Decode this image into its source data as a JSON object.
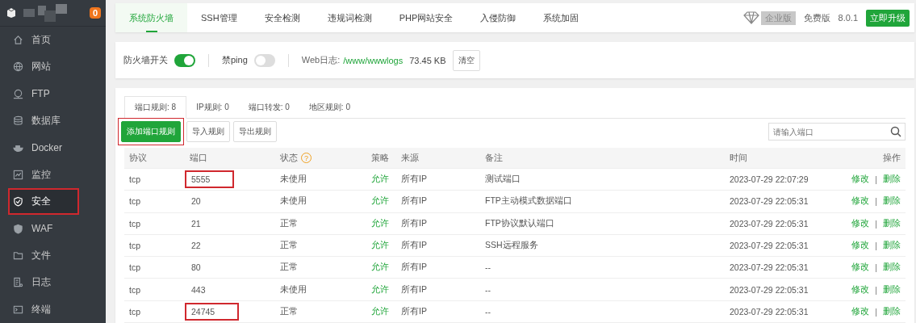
{
  "sidebar": {
    "badge": "0",
    "items": [
      {
        "label": "首页",
        "selected": false,
        "annotated": false
      },
      {
        "label": "网站",
        "selected": false,
        "annotated": false
      },
      {
        "label": "FTP",
        "selected": false,
        "annotated": false
      },
      {
        "label": "数据库",
        "selected": false,
        "annotated": false
      },
      {
        "label": "Docker",
        "selected": false,
        "annotated": false
      },
      {
        "label": "监控",
        "selected": false,
        "annotated": false
      },
      {
        "label": "安全",
        "selected": true,
        "annotated": true
      },
      {
        "label": "WAF",
        "selected": false,
        "annotated": false
      },
      {
        "label": "文件",
        "selected": false,
        "annotated": false
      },
      {
        "label": "日志",
        "selected": false,
        "annotated": false
      },
      {
        "label": "终端",
        "selected": false,
        "annotated": false
      }
    ]
  },
  "tabs": [
    {
      "label": "系统防火墙",
      "selected": true
    },
    {
      "label": "SSH管理",
      "selected": false
    },
    {
      "label": "安全检测",
      "selected": false
    },
    {
      "label": "违规词检测",
      "selected": false
    },
    {
      "label": "PHP网站安全",
      "selected": false
    },
    {
      "label": "入侵防御",
      "selected": false
    },
    {
      "label": "系统加固",
      "selected": false
    }
  ],
  "edition": {
    "enterprise": "企业版",
    "free": "免费版",
    "version": "8.0.1",
    "upgrade": "立即升级"
  },
  "controls": {
    "firewall": {
      "label": "防火墙开关",
      "on": true
    },
    "ping": {
      "label": "禁ping",
      "on": false
    },
    "web_log_label": "Web日志:",
    "web_log_path": "/www/wwwlogs",
    "web_log_size": "73.45 KB",
    "clear": "清空"
  },
  "sub_tabs": [
    {
      "label": "端口规则: 8",
      "selected": true
    },
    {
      "label": "IP规则: 0",
      "selected": false
    },
    {
      "label": "端口转发: 0",
      "selected": false
    },
    {
      "label": "地区规则: 0",
      "selected": false
    }
  ],
  "actions": [
    {
      "label": "添加端口规则",
      "kind": "primary",
      "annotated": true
    },
    {
      "label": "导入规则",
      "kind": "default",
      "annotated": false
    },
    {
      "label": "导出规则",
      "kind": "default",
      "annotated": false
    }
  ],
  "search": {
    "placeholder": "请输入端口"
  },
  "table": {
    "columns": [
      "协议",
      "端口",
      "状态",
      "策略",
      "来源",
      "备注",
      "时间",
      "操作"
    ],
    "status_help": "?",
    "rows": [
      {
        "protocol": "tcp",
        "port": "5555",
        "port_annotated": true,
        "status": "未使用",
        "policy": "允许",
        "source": "所有IP",
        "note": "测试端口",
        "time": "2023-07-29 22:07:29",
        "edit": "修改",
        "separator": "|",
        "delete": "删除"
      },
      {
        "protocol": "tcp",
        "port": "20",
        "port_annotated": false,
        "status": "未使用",
        "policy": "允许",
        "source": "所有IP",
        "note": "FTP主动模式数据端口",
        "time": "2023-07-29 22:05:31",
        "edit": "修改",
        "separator": "|",
        "delete": "删除"
      },
      {
        "protocol": "tcp",
        "port": "21",
        "port_annotated": false,
        "status": "正常",
        "policy": "允许",
        "source": "所有IP",
        "note": "FTP协议默认端口",
        "time": "2023-07-29 22:05:31",
        "edit": "修改",
        "separator": "|",
        "delete": "删除"
      },
      {
        "protocol": "tcp",
        "port": "22",
        "port_annotated": false,
        "status": "正常",
        "policy": "允许",
        "source": "所有IP",
        "note": "SSH远程服务",
        "time": "2023-07-29 22:05:31",
        "edit": "修改",
        "separator": "|",
        "delete": "删除"
      },
      {
        "protocol": "tcp",
        "port": "80",
        "port_annotated": false,
        "status": "正常",
        "policy": "允许",
        "source": "所有IP",
        "note": "--",
        "time": "2023-07-29 22:05:31",
        "edit": "修改",
        "separator": "|",
        "delete": "删除"
      },
      {
        "protocol": "tcp",
        "port": "443",
        "port_annotated": false,
        "status": "未使用",
        "policy": "允许",
        "source": "所有IP",
        "note": "--",
        "time": "2023-07-29 22:05:31",
        "edit": "修改",
        "separator": "|",
        "delete": "删除"
      },
      {
        "protocol": "tcp",
        "port": "24745",
        "port_annotated": true,
        "status": "正常",
        "policy": "允许",
        "source": "所有IP",
        "note": "--",
        "time": "2023-07-29 22:05:31",
        "edit": "修改",
        "separator": "|",
        "delete": "删除"
      }
    ]
  }
}
